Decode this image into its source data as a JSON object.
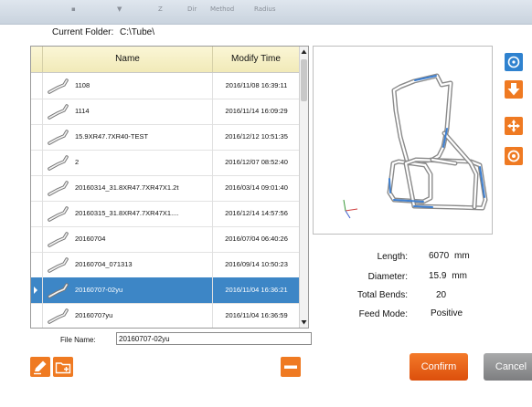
{
  "titlebar": {
    "faint_items": [
      "▪",
      "▼",
      "Z",
      "Dir",
      "Method",
      "Radius"
    ]
  },
  "folder": {
    "label": "Current Folder:",
    "path": "C:\\Tube\\"
  },
  "table": {
    "headers": {
      "name": "Name",
      "time": "Modify Time"
    },
    "rows": [
      {
        "name": "1108",
        "time": "2016/11/08 16:39:11"
      },
      {
        "name": "1114",
        "time": "2016/11/14 16:09:29"
      },
      {
        "name": "15.9XR47.7XR40-TEST",
        "time": "2016/12/12 10:51:35"
      },
      {
        "name": "2",
        "time": "2016/12/07 08:52:40"
      },
      {
        "name": "20160314_31.8XR47.7XR47X1.2t",
        "time": "2016/03/14 09:01:40"
      },
      {
        "name": "20160315_31.8XR47.7XR47X1....",
        "time": "2016/12/14 14:57:56"
      },
      {
        "name": "20160704",
        "time": "2016/07/04 06:40:26"
      },
      {
        "name": "20160704_071313",
        "time": "2016/09/14 10:50:23"
      },
      {
        "name": "20160707-02yu",
        "time": "2016/11/04 16:36:21",
        "selected": true
      },
      {
        "name": "20160707yu",
        "time": "2016/11/04 16:36:59"
      }
    ]
  },
  "info": {
    "length_label": "Length:",
    "length_value": "6070",
    "length_unit": "mm",
    "diameter_label": "Diameter:",
    "diameter_value": "15.9",
    "diameter_unit": "mm",
    "bends_label": "Total Bends:",
    "bends_value": "20",
    "feed_label": "Feed Mode:",
    "feed_value": "Positive"
  },
  "file": {
    "label": "File Name:",
    "value": "20160707-02yu"
  },
  "buttons": {
    "confirm": "Confirm",
    "cancel": "Cancel"
  },
  "colors": {
    "accent_blue": "#3d86c6",
    "accent_orange": "#ef6a1d",
    "grey_button": "#8e8f91"
  }
}
